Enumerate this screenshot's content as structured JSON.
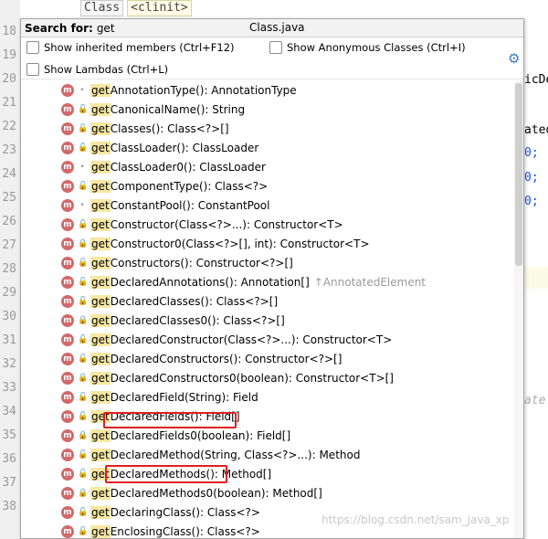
{
  "editor": {
    "crumbs": [
      "Class",
      "<clinit>"
    ],
    "line_numbers": [
      "18",
      "19",
      "20",
      "21",
      "22",
      "23",
      "24",
      "25",
      "26",
      "27",
      "28",
      "29",
      "30",
      "31",
      "32",
      "33",
      "34",
      "35",
      "36",
      "37",
      "38"
    ],
    "code_fragments": [
      "icDe",
      "ated",
      "0;",
      "0;",
      "0;",
      "ate."
    ]
  },
  "popup": {
    "search_label": "Search for:",
    "search_value": "get",
    "title": "Class.java",
    "options": [
      {
        "label": "Show inherited members (Ctrl+F12)",
        "checked": false
      },
      {
        "label": "Show Anonymous Classes (Ctrl+I)",
        "checked": false
      },
      {
        "label": "Show Lambdas (Ctrl+L)",
        "checked": false
      }
    ],
    "settings_icon": "gear-icon",
    "member_badge": "m",
    "match_prefix": "get",
    "items": [
      {
        "rest": "AnnotationType(): AnnotationType",
        "vis": "pkg"
      },
      {
        "rest": "CanonicalName(): String",
        "vis": "pub"
      },
      {
        "rest": "Classes(): Class<?>[]",
        "vis": "pub"
      },
      {
        "rest": "ClassLoader(): ClassLoader",
        "vis": "pub"
      },
      {
        "rest": "ClassLoader0(): ClassLoader",
        "vis": "pkg"
      },
      {
        "rest": "ComponentType(): Class<?>",
        "vis": "pub"
      },
      {
        "rest": "ConstantPool(): ConstantPool",
        "vis": "pkg"
      },
      {
        "rest": "Constructor(Class<?>...): Constructor<T>",
        "vis": "pub"
      },
      {
        "rest": "Constructor0(Class<?>[], int): Constructor<T>",
        "vis": "priv"
      },
      {
        "rest": "Constructors(): Constructor<?>[]",
        "vis": "pub"
      },
      {
        "rest": "DeclaredAnnotations(): Annotation[]",
        "vis": "pub",
        "inherit": "↑AnnotatedElement"
      },
      {
        "rest": "DeclaredClasses(): Class<?>[]",
        "vis": "pub"
      },
      {
        "rest": "DeclaredClasses0(): Class<?>[]",
        "vis": "priv"
      },
      {
        "rest": "DeclaredConstructor(Class<?>...): Constructor<T>",
        "vis": "pub"
      },
      {
        "rest": "DeclaredConstructors(): Constructor<?>[]",
        "vis": "pub"
      },
      {
        "rest": "DeclaredConstructors0(boolean): Constructor<T>[]",
        "vis": "priv"
      },
      {
        "rest": "DeclaredField(String): Field",
        "vis": "pub"
      },
      {
        "rest": "DeclaredFields(): Field[]",
        "vis": "pub"
      },
      {
        "rest": "DeclaredFields0(boolean): Field[]",
        "vis": "priv"
      },
      {
        "rest": "DeclaredMethod(String, Class<?>...): Method",
        "vis": "pub"
      },
      {
        "rest": "DeclaredMethods(): Method[]",
        "vis": "pub"
      },
      {
        "rest": "DeclaredMethods0(boolean): Method[]",
        "vis": "priv"
      },
      {
        "rest": "DeclaringClass(): Class<?>",
        "vis": "pub"
      },
      {
        "rest": "EnclosingClass(): Class<?>",
        "vis": "pub"
      }
    ]
  },
  "watermark": "https://blog.csdn.net/sam_java_xp",
  "colors": {
    "match_highlight": "#f7e7a1",
    "method_badge": "#d16a6a",
    "annotation_box": "#e02020"
  }
}
